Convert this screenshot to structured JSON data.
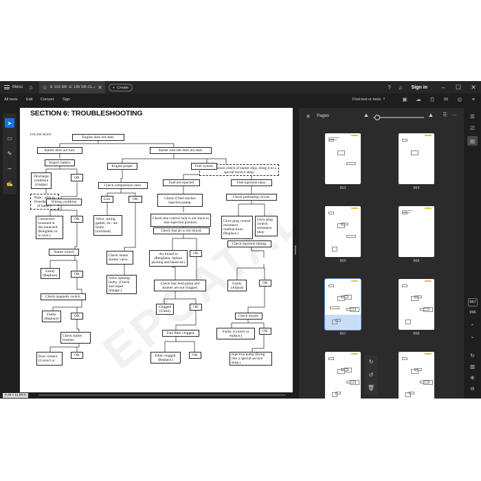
{
  "titlebar": {
    "menu_label": "Menu",
    "tab_title": "E 115 SR -E 135 SR-CL.AW...",
    "create_label": "Create",
    "signin_label": "Sign in"
  },
  "menubar": {
    "items": [
      "All tools",
      "Edit",
      "Convert",
      "Sign"
    ],
    "find_label": "Find text or tools"
  },
  "document": {
    "title": "SECTION 6: TROUBLESHOOTING",
    "subtitle": "ENGINE BODY",
    "watermark": "EPCATALOG.COM",
    "size_label": "8,26 x 11,69 in",
    "flowchart": {
      "n1": "Engine does not start.",
      "n2": "Starter does not turn.",
      "n3": "Starter runs but does not start.",
      "n4": "Inspect battery",
      "n5": "Note ; If pinion clutch of starter slips, bring it to a special service shop.",
      "n6": "Discharge condition (charge)",
      "n7": "OK",
      "n8": "Engine proper",
      "n9": "Fuel system",
      "n10": "Note ; refer to Overdischarge of battery.",
      "n11": "Check compression ratio.",
      "n12": "Fuel not injected",
      "n13": "Fuel injection okay.",
      "n14": "Wiring condition",
      "n15": "Low",
      "n16": "OK",
      "n17": "Check if fuel reaches injection pump.",
      "n18": "Check preheating circuit.",
      "n19": "Connectors loosened or disconnected. (Retighten or re-wire.)",
      "n20": "OK",
      "n21": "Valve, spring, gasket, etc. are faulty. (overhaul)",
      "n22": "Check that control rack is not stuck in non-injection position.",
      "n23": "Glow plug control resistance malfunctions. (Replace.)",
      "n24": "Glow plug control resistance okay.",
      "n25": "Check that air is not mixed.",
      "n26": "Starter switch",
      "n27": "Check intake shutter valve.",
      "n28": "Air mixed in (Retighten, replace packing and bleed air.)",
      "n29": "OK",
      "n30": "Check injection timing.",
      "n31": "Faulty (Replace)",
      "n32": "OK",
      "n33": "Valve opening faulty. (Check and repair linkage.)",
      "n34": "Check that feed pump and strainer are not clogged.",
      "n35": "Faulty (Adjust)",
      "n36": "OK",
      "n37": "Check magnetic switch.",
      "n38": "Clogged (Clean)",
      "n39": "OK",
      "n40": "Check nozzle.",
      "n41": "Faulty (Replace)",
      "n42": "OK",
      "n43": "Fuel filter clogged.",
      "n44": "Faulty (Correct or replace.)",
      "n45": "OK",
      "n46": "Check starter brushes.",
      "n47": "Poor contact. (Correct or",
      "n48": "OK",
      "n49": "Filter clogged. (Replace.)",
      "n50": "OK",
      "n51": "Injection pump (Bring into a special service shop.)"
    }
  },
  "pages_panel": {
    "title": "Pages",
    "zoom_fraction": 0.08,
    "thumbnails": [
      {
        "label": "863"
      },
      {
        "label": "864"
      },
      {
        "label": "865"
      },
      {
        "label": "866"
      },
      {
        "label": "867"
      },
      {
        "label": "868"
      },
      {
        "label": ""
      },
      {
        "label": ""
      }
    ]
  },
  "right_rail": {
    "current_page": "867",
    "total_pages": "996"
  },
  "colors": {
    "accent": "#1473e6",
    "app_bg": "#1e1e1e",
    "panel_bg": "#2b2b2b"
  }
}
